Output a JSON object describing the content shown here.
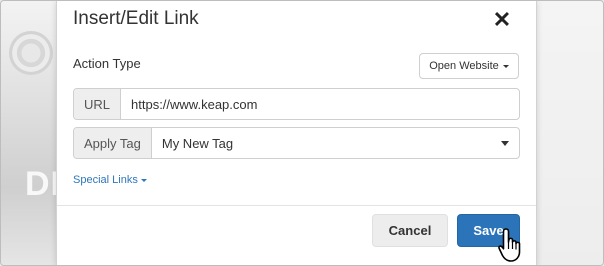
{
  "dialog": {
    "title": "Insert/Edit Link",
    "close_symbol": "✕",
    "close_icon": "close-icon"
  },
  "action_type": {
    "label": "Action Type",
    "dropdown_value": "Open Website"
  },
  "url_field": {
    "addon_label": "URL",
    "value": "https://www.keap.com"
  },
  "apply_tag": {
    "addon_label": "Apply Tag",
    "selected_value": "My New Tag"
  },
  "special_links": {
    "label": "Special Links"
  },
  "footer": {
    "cancel_label": "Cancel",
    "save_label": "Save"
  },
  "backdrop": {
    "partial_text": "DER"
  },
  "colors": {
    "primary": "#2b74b9",
    "link": "#2e77bb",
    "cancel_bg": "#ededed"
  },
  "cursor": {
    "icon": "hand-pointer-icon"
  }
}
